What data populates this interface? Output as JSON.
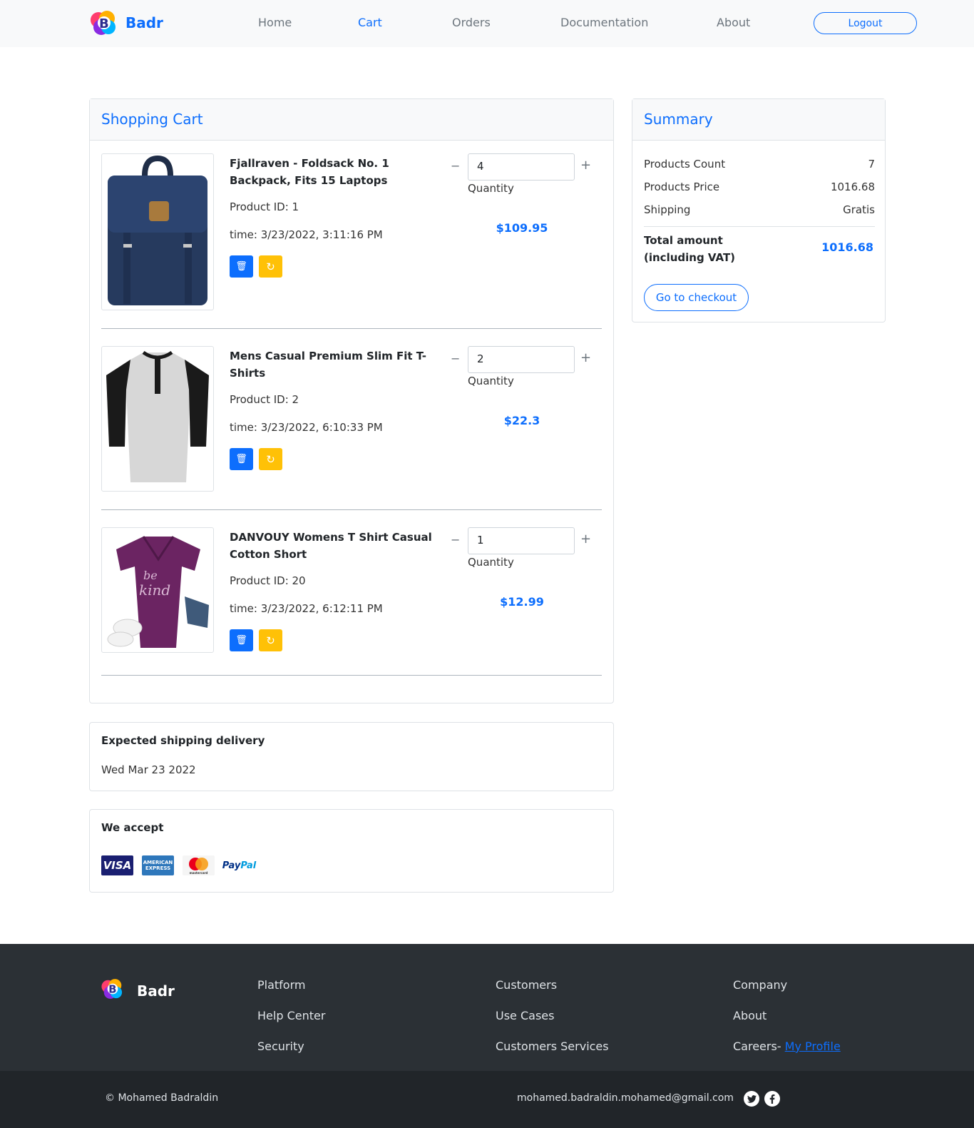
{
  "header": {
    "brand": "Badr",
    "nav": [
      "Home",
      "Cart",
      "Orders",
      "Documentation",
      "About"
    ],
    "active": "Cart",
    "logout": "Logout"
  },
  "cart": {
    "title": "Shopping Cart",
    "quantity_label": "Quantity",
    "items": [
      {
        "title": "Fjallraven - Foldsack No. 1 Backpack, Fits 15 Laptops",
        "product_id": "Product ID: 1",
        "time": "time: 3/23/2022, 3:11:16 PM",
        "quantity": "4",
        "price": "$109.95",
        "image_icon": "backpack-image"
      },
      {
        "title": "Mens Casual Premium Slim Fit T-Shirts",
        "product_id": "Product ID: 2",
        "time": "time: 3/23/2022, 6:10:33 PM",
        "quantity": "2",
        "price": "$22.3",
        "image_icon": "tshirt-image"
      },
      {
        "title": "DANVOUY Womens T Shirt Casual Cotton Short",
        "product_id": "Product ID: 20",
        "time": "time: 3/23/2022, 6:12:11 PM",
        "quantity": "1",
        "price": "$12.99",
        "image_icon": "womens-tshirt-image"
      }
    ]
  },
  "summary": {
    "title": "Summary",
    "rows": [
      {
        "label": "Products Count",
        "value": "7"
      },
      {
        "label": "Products Price",
        "value": "1016.68"
      },
      {
        "label": "Shipping",
        "value": "Gratis"
      }
    ],
    "total_label": "Total amount (including VAT)",
    "total_value": "1016.68",
    "checkout": "Go to checkout"
  },
  "shipping": {
    "title": "Expected shipping delivery",
    "date": "Wed Mar 23 2022"
  },
  "accept": {
    "title": "We accept",
    "visa": "VISA",
    "amex": "AMERICAN EXPRESS",
    "paypal_a": "Pay",
    "paypal_b": "Pal",
    "mc_text": "mastercard"
  },
  "footer": {
    "brand": "Badr",
    "col1": [
      "Platform",
      "Help Center",
      "Security"
    ],
    "col2": [
      "Customers",
      "Use Cases",
      "Customers Services"
    ],
    "col3": [
      "Company",
      "About"
    ],
    "careers": "Careers-",
    "my_profile": "My Profile",
    "copyright": "© Mohamed Badraldin",
    "email": "mohamed.badraldin.mohamed@gmail.com",
    "twitter_icon": "twitter-icon",
    "facebook_icon": "facebook-icon"
  },
  "colors": {
    "accent": "#0d6efd",
    "warning": "#ffc107",
    "footer_bg": "#2b3035",
    "bottom_bg": "#212529"
  }
}
